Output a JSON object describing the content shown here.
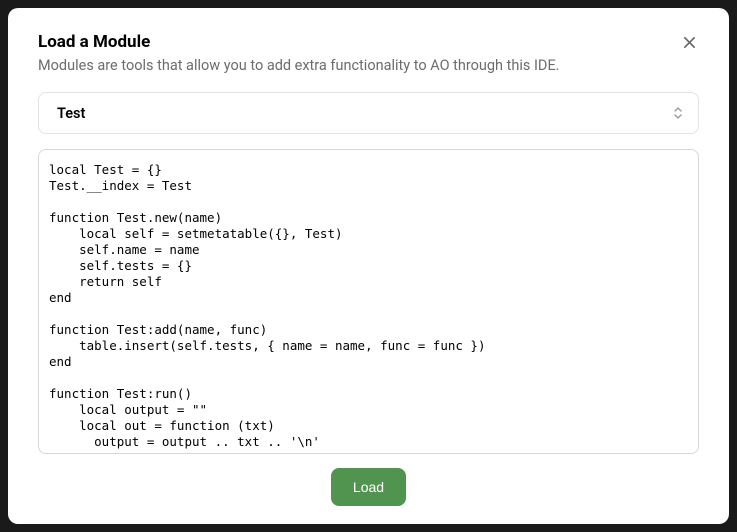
{
  "modal": {
    "title": "Load a Module",
    "subtitle": "Modules are tools that allow you to add extra functionality to AO through this IDE.",
    "select": {
      "value": "Test"
    },
    "code": "local Test = {}\nTest.__index = Test\n\nfunction Test.new(name)\n    local self = setmetatable({}, Test)\n    self.name = name\n    self.tests = {}\n    return self\nend\n\nfunction Test:add(name, func)\n    table.insert(self.tests, { name = name, func = func })\nend\n\nfunction Test:run()\n    local output = \"\"\n    local out = function (txt)\n      output = output .. txt .. '\\n'",
    "load_button": "Load"
  }
}
